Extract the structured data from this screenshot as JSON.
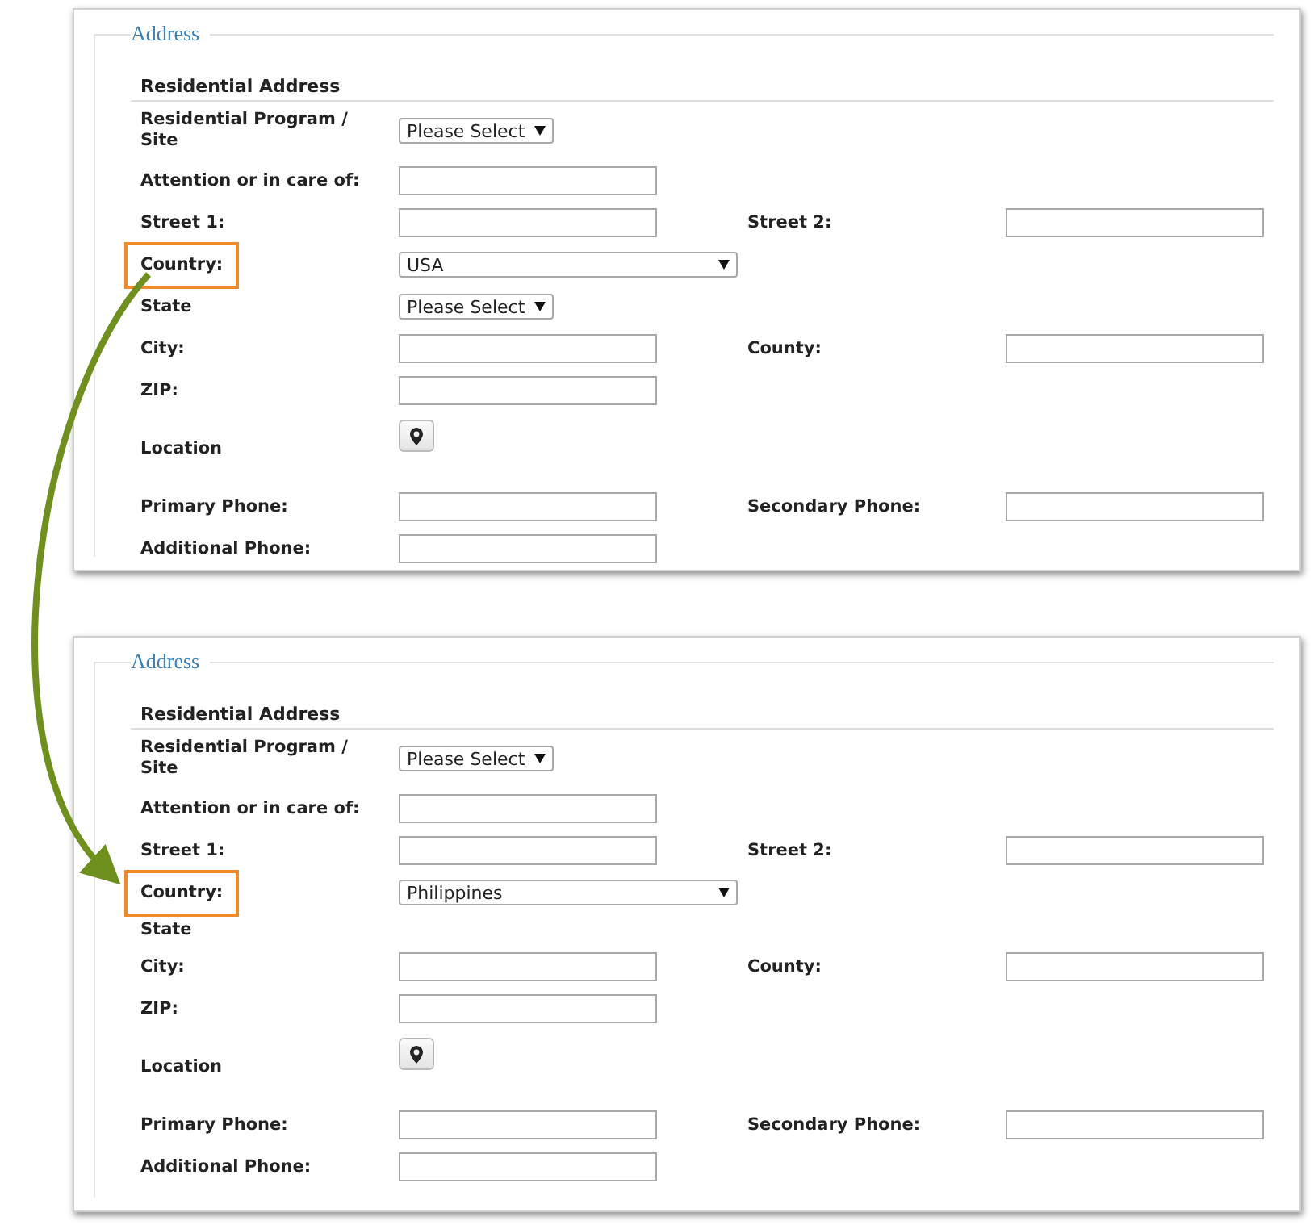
{
  "panels": [
    {
      "legend": "Address",
      "section": "Residential Address",
      "rows": [
        {
          "label": "Residential Program / Site",
          "highlighted": false,
          "field": {
            "kind": "select",
            "value": "Please Select",
            "wide": false
          }
        },
        {
          "label": "Attention or in care of:",
          "highlighted": false,
          "field": {
            "kind": "text"
          }
        },
        {
          "label": "Street 1:",
          "highlighted": false,
          "field": {
            "kind": "text"
          },
          "label_2": "Street 2:",
          "field_2": {
            "kind": "text"
          }
        },
        {
          "label": "Country:",
          "highlighted": true,
          "field": {
            "kind": "select",
            "value": "USA",
            "wide": true
          }
        },
        {
          "label": "State",
          "highlighted": false,
          "field": {
            "kind": "select",
            "value": "Please Select",
            "wide": false
          }
        },
        {
          "label": "City:",
          "highlighted": false,
          "field": {
            "kind": "text"
          },
          "label_2": "County:",
          "field_2": {
            "kind": "text"
          }
        },
        {
          "label": "ZIP:",
          "highlighted": false,
          "field": {
            "kind": "text"
          }
        },
        {
          "label": "Location",
          "highlighted": false,
          "field": {
            "kind": "location"
          }
        },
        {
          "label": "Primary Phone:",
          "highlighted": false,
          "field": {
            "kind": "text"
          },
          "label_2": "Secondary Phone:",
          "field_2": {
            "kind": "text"
          }
        },
        {
          "label": "Additional Phone:",
          "highlighted": false,
          "field": {
            "kind": "text"
          }
        }
      ]
    },
    {
      "legend": "Address",
      "section": "Residential Address",
      "rows": [
        {
          "label": "Residential Program / Site",
          "highlighted": false,
          "field": {
            "kind": "select",
            "value": "Please Select",
            "wide": false
          }
        },
        {
          "label": "Attention or in care of:",
          "highlighted": false,
          "field": {
            "kind": "text"
          }
        },
        {
          "label": "Street 1:",
          "highlighted": false,
          "field": {
            "kind": "text"
          },
          "label_2": "Street 2:",
          "field_2": {
            "kind": "text"
          }
        },
        {
          "label": "Country:",
          "highlighted": true,
          "field": {
            "kind": "select",
            "value": "Philippines",
            "wide": true
          }
        },
        {
          "label": "State",
          "highlighted": false
        },
        {
          "label": "City:",
          "highlighted": false,
          "field": {
            "kind": "text"
          },
          "label_2": "County:",
          "field_2": {
            "kind": "text"
          }
        },
        {
          "label": "ZIP:",
          "highlighted": false,
          "field": {
            "kind": "text"
          }
        },
        {
          "label": "Location",
          "highlighted": false,
          "field": {
            "kind": "location"
          }
        },
        {
          "label": "Primary Phone:",
          "highlighted": false,
          "field": {
            "kind": "text"
          },
          "label_2": "Secondary Phone:",
          "field_2": {
            "kind": "text"
          }
        },
        {
          "label": "Additional Phone:",
          "highlighted": false,
          "field": {
            "kind": "text"
          }
        }
      ]
    }
  ]
}
